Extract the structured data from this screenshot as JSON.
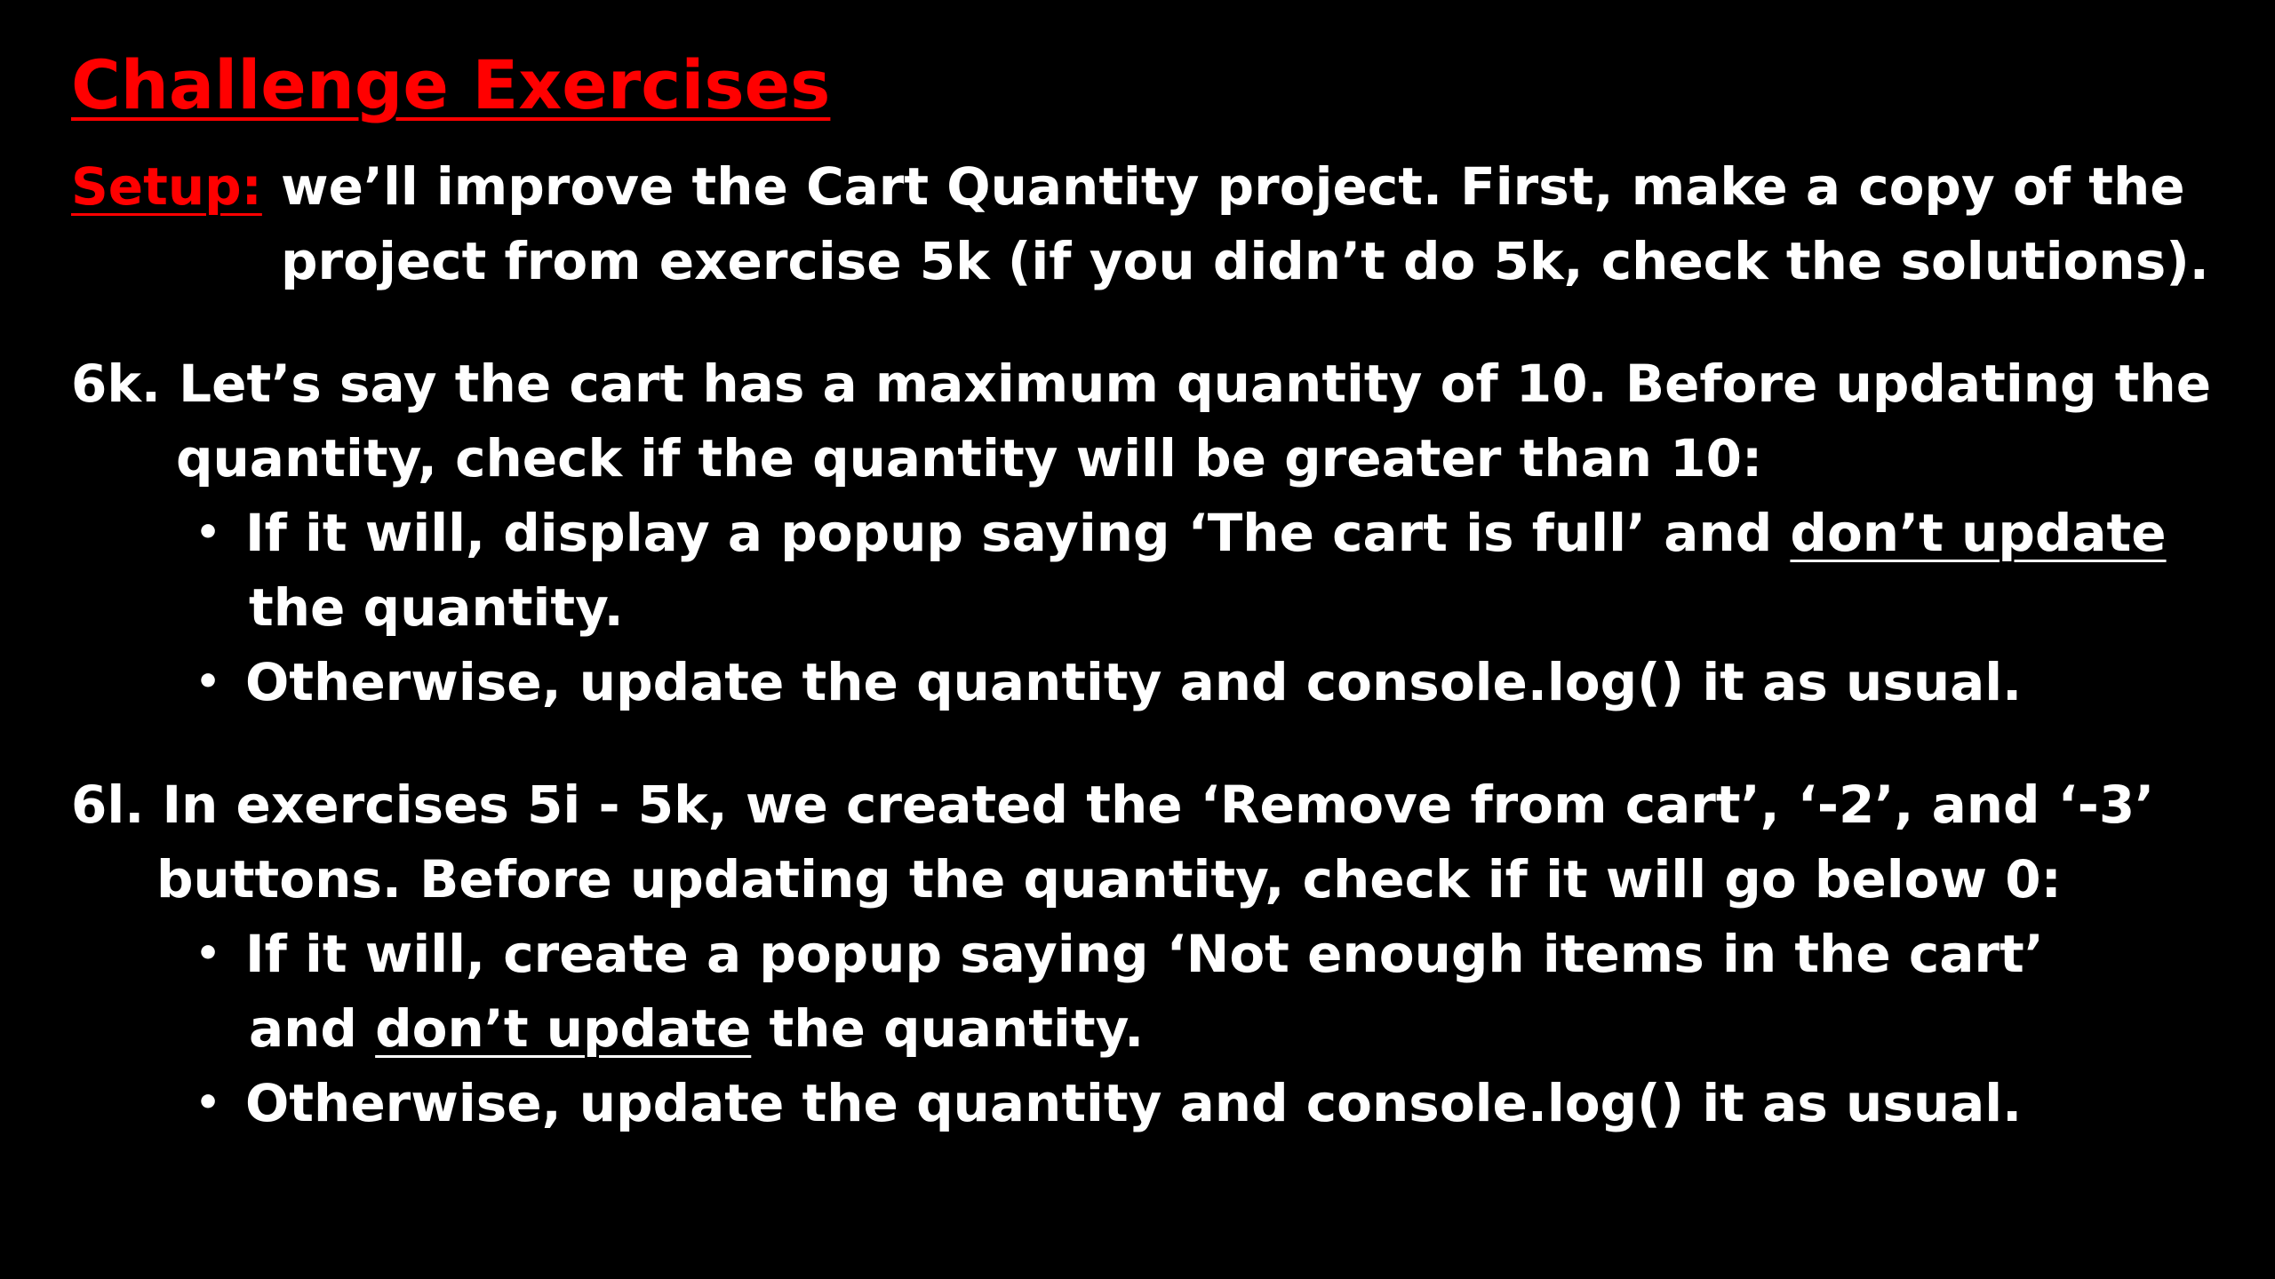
{
  "title": "Challenge Exercises",
  "setup": {
    "label": "Setup:",
    "line1": "we’ll improve the Cart Quantity project. First, make a copy of the",
    "line2": "project from exercise 5k (if you didn’t do 5k, check the solutions)."
  },
  "ex6k": {
    "line1": "6k. Let’s say the cart has a maximum quantity of 10. Before updating the",
    "line2": "quantity, check if the quantity will be greater than 10:",
    "bullet1": {
      "dot": "•",
      "pre": "If it will, display a popup saying ‘The cart is full’ and ",
      "underlined": "don’t update",
      "line2": "the quantity."
    },
    "bullet2": {
      "dot": "•",
      "text": "Otherwise, update the quantity and console.log() it as usual."
    }
  },
  "ex6l": {
    "line1": "6l. In exercises 5i - 5k, we created the ‘Remove from cart’, ‘-2’, and ‘-3’",
    "line2": "buttons. Before updating the quantity, check if it will go below 0:",
    "bullet1": {
      "dot": "•",
      "text": "If it will, create a popup saying ‘Not enough items in the cart’",
      "line2_pre": "and ",
      "line2_underlined": "don’t update",
      "line2_post": " the quantity."
    },
    "bullet2": {
      "dot": "•",
      "text": "Otherwise, update the quantity and console.log() it as usual."
    }
  },
  "colors": {
    "background": "#000000",
    "text": "#ffffff",
    "accent": "#ff0000"
  }
}
